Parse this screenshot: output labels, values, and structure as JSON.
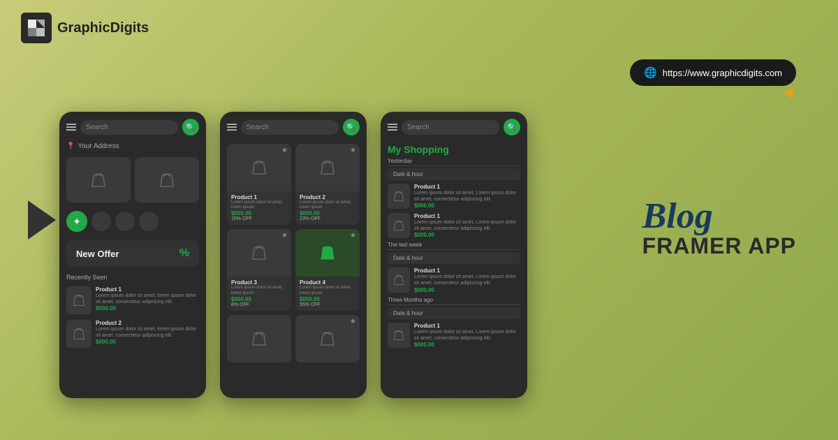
{
  "header": {
    "logo_text": "GraphicDigits",
    "url": "https://www.graphicdigits.com"
  },
  "blog": {
    "title": "Blog",
    "subtitle": "FRAMER APP"
  },
  "phone1": {
    "search_placeholder": "Search",
    "address_label": "Your Address",
    "new_offer_label": "New Offer",
    "recently_seen_label": "Recently Seen",
    "products": [
      {
        "name": "Product 1",
        "desc": "Lorem ipsum dolor sit amet, lorem ipsum dolor sit amet, consectetur adipiscing elit.",
        "price": "$000.00"
      },
      {
        "name": "Product 2",
        "desc": "Lorem ipsum dolor sit amet, lorem ipsum dolor sit amet, consectetur adipiscing elit.",
        "price": "$000.00"
      }
    ]
  },
  "phone2": {
    "search_placeholder": "Search",
    "products": [
      {
        "name": "Product 1",
        "desc": "Lorem ipsum dolor sit amet, lorem ipsum",
        "price": "$000.00",
        "off": "15% OFF"
      },
      {
        "name": "Product 2",
        "desc": "Lorem ipsum dolor sit amet, lorem ipsum",
        "price": "$000.00",
        "off": "23% OFF"
      },
      {
        "name": "Product 3",
        "desc": "Lorem ipsum dolor sit amet, lorem ipsum",
        "price": "$000.00",
        "off": "8% OFF"
      },
      {
        "name": "Product 4",
        "desc": "Lorem ipsum dolor sit amet, lorem ipsum",
        "price": "$000.00",
        "off": "55% OFF"
      }
    ]
  },
  "phone3": {
    "search_placeholder": "Search",
    "my_shopping_label": "My Shopping",
    "yesterday_label": "Yesterday",
    "last_week_label": "The last week",
    "three_months_label": "Three Months ago",
    "date_hour_label": "Date & hour",
    "products": [
      {
        "name": "Product 1",
        "desc": "Lorem ipsum dolor sit amet, Lorem ipsum dolor sit amet, consectetur adipiscing elit.",
        "price": "$000.00"
      },
      {
        "name": "Product 1",
        "desc": "Lorem ipsum dolor sit amet, Lorem ipsum dolor sit amet, consectetur adipiscing elit.",
        "price": "$000.00"
      },
      {
        "name": "Product 1",
        "desc": "Lorem ipsum dolor sit amet, Lorem ipsum dolor sit amet, consectetur adipiscing elit.",
        "price": "$000.00"
      },
      {
        "name": "Product 1",
        "desc": "Lorem ipsum dolor sit amet, Lorem ipsum dolor sit amet, consectetur adipiscing elit.",
        "price": "$000.00"
      }
    ]
  }
}
